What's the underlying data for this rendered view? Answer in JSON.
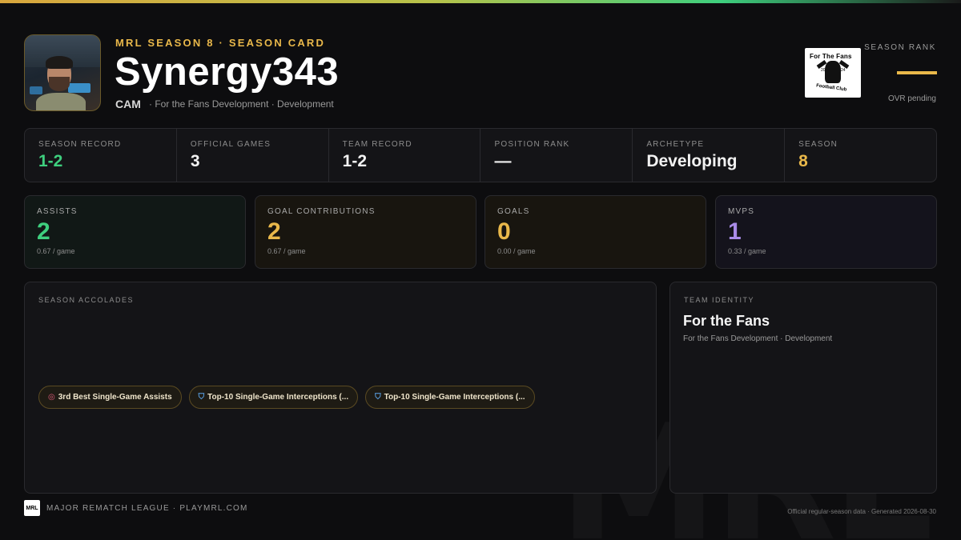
{
  "header": {
    "league_line": "MRL SEASON 8 · SEASON CARD",
    "player_name": "Synergy343",
    "position": "CAM",
    "team_line": "· For the Fans Development · Development"
  },
  "team_logo": {
    "top_text": "For The Fans",
    "bottom_text": "Football Club",
    "year_left": "20",
    "year_right": "24"
  },
  "rank": {
    "label": "SEASON RANK",
    "value": "—",
    "pending": "OVR pending"
  },
  "stats": [
    {
      "label": "SEASON RECORD",
      "value": "1-2",
      "color": "#3ecf7e"
    },
    {
      "label": "OFFICIAL GAMES",
      "value": "3",
      "color": "#f2f2f2"
    },
    {
      "label": "TEAM RECORD",
      "value": "1-2",
      "color": "#f2f2f2"
    },
    {
      "label": "POSITION RANK",
      "value": "—",
      "color": "#f2f2f2"
    },
    {
      "label": "ARCHETYPE",
      "value": "Developing",
      "color": "#f2f2f2"
    },
    {
      "label": "SEASON",
      "value": "8",
      "color": "#e9b84a"
    }
  ],
  "metrics": [
    {
      "label": "ASSISTS",
      "value": "2",
      "per_game": "0.67 / game",
      "color": "#3ecf7e"
    },
    {
      "label": "GOAL CONTRIBUTIONS",
      "value": "2",
      "per_game": "0.67 / game",
      "color": "#e9b84a"
    },
    {
      "label": "GOALS",
      "value": "0",
      "per_game": "0.00 / game",
      "color": "#e9b84a"
    },
    {
      "label": "MVPS",
      "value": "1",
      "per_game": "0.33 / game",
      "color": "#a98be8"
    }
  ],
  "accolades": {
    "label": "SEASON ACCOLADES",
    "items": [
      {
        "icon": "target-icon",
        "text": "3rd Best Single-Game Assists"
      },
      {
        "icon": "shield-icon",
        "text": "Top-10 Single-Game Interceptions (..."
      },
      {
        "icon": "shield-icon",
        "text": "Top-10 Single-Game Interceptions (..."
      }
    ]
  },
  "identity": {
    "label": "TEAM IDENTITY",
    "name": "For the Fans",
    "sub": "For the Fans Development · Development"
  },
  "footer": {
    "logo_text": "MRL",
    "left": "MAJOR REMATCH LEAGUE · PLAYMRL.COM",
    "right": "Official regular-season data · Generated 2026-08-30"
  },
  "watermark": "MRL"
}
